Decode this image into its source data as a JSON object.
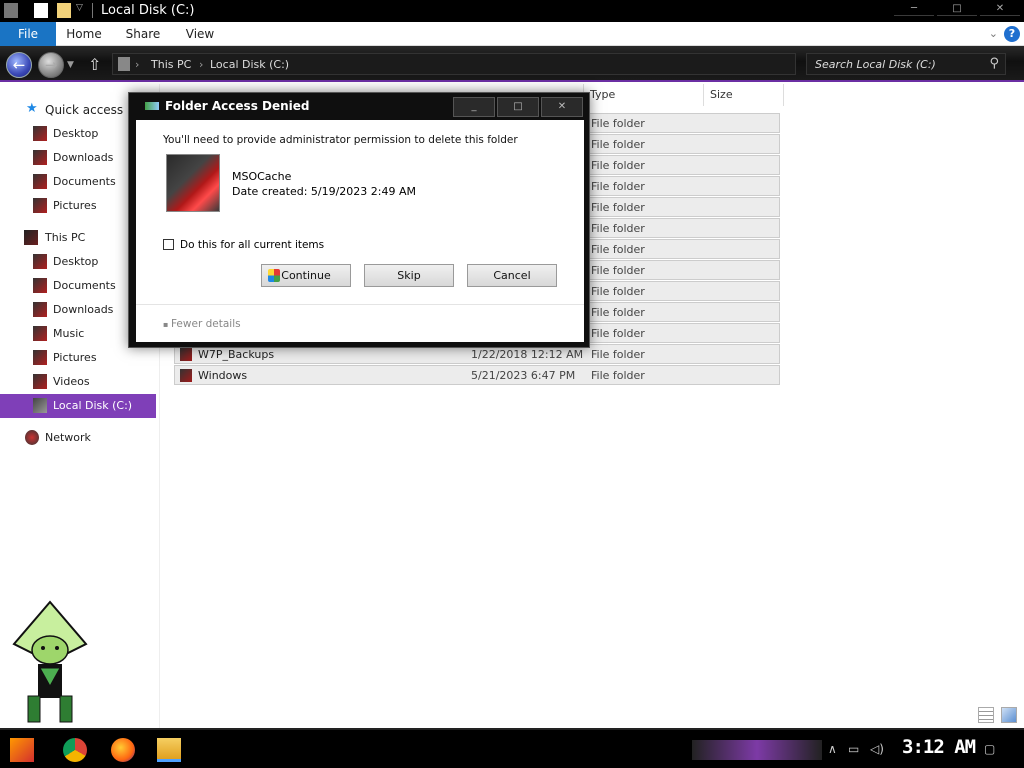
{
  "window": {
    "title": "Local Disk (C:)",
    "controls": [
      "─",
      "□",
      "✕"
    ]
  },
  "ribbon": {
    "tabs": [
      "File",
      "Home",
      "Share",
      "View"
    ],
    "help": "?"
  },
  "address": {
    "crumbs": [
      "This PC",
      "Local Disk (C:)"
    ],
    "sep": "›"
  },
  "search": {
    "placeholder": "Search Local Disk (C:)"
  },
  "sidebar": {
    "quick_access": "Quick access",
    "quick_items": [
      "Desktop",
      "Downloads",
      "Documents",
      "Pictures"
    ],
    "this_pc": "This PC",
    "pc_items": [
      "Desktop",
      "Documents",
      "Downloads",
      "Music",
      "Pictures",
      "Videos",
      "Local Disk (C:)"
    ],
    "network": "Network"
  },
  "columns": {
    "type": "Type",
    "size": "Size"
  },
  "files": [
    {
      "name": "",
      "date": "",
      "type": "File folder"
    },
    {
      "name": "",
      "date": "",
      "type": "File folder"
    },
    {
      "name": "",
      "date": "",
      "type": "File folder"
    },
    {
      "name": "",
      "date": "",
      "type": "File folder"
    },
    {
      "name": "",
      "date": "",
      "type": "File folder"
    },
    {
      "name": "",
      "date": "",
      "type": "File folder"
    },
    {
      "name": "",
      "date": "",
      "type": "File folder"
    },
    {
      "name": "",
      "date": "",
      "type": "File folder"
    },
    {
      "name": "",
      "date": "",
      "type": "File folder"
    },
    {
      "name": "",
      "date": "",
      "type": "File folder"
    },
    {
      "name": "",
      "date": "",
      "type": "File folder"
    },
    {
      "name": "W7P_Backups",
      "date": "1/22/2018 12:12 AM",
      "type": "File folder"
    },
    {
      "name": "Windows",
      "date": "5/21/2023 6:47 PM",
      "type": "File folder"
    }
  ],
  "dialog": {
    "title": "Folder Access Denied",
    "message": "You'll need to provide administrator permission to delete this folder",
    "folder_name": "MSOCache",
    "folder_date": "Date created: 5/19/2023 2:49 AM",
    "checkbox_label": "Do this for all current items",
    "checkbox_checked": false,
    "continue": "Continue",
    "skip": "Skip",
    "cancel": "Cancel",
    "details": "Fewer details",
    "controls": [
      "_",
      "□",
      "✕"
    ]
  },
  "taskbar": {
    "clock": "3:12 AM"
  },
  "colors": {
    "accent_purple": "#7f3fb8",
    "file_tab_blue": "#1a74c4"
  }
}
